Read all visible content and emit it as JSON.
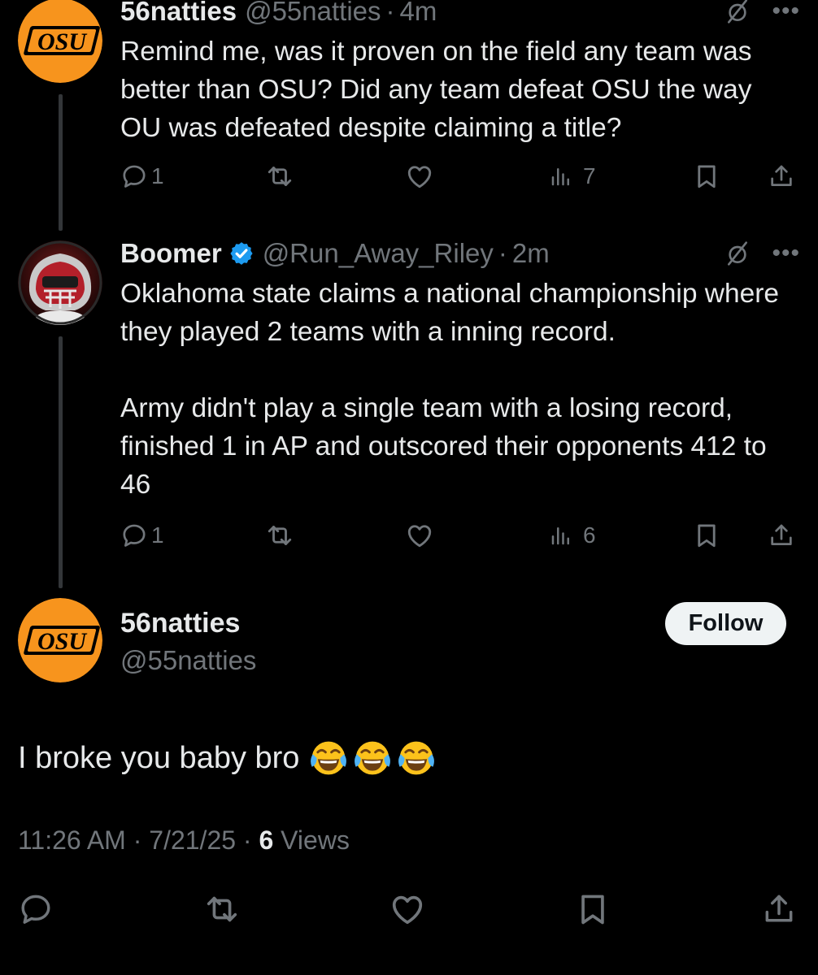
{
  "tweets": [
    {
      "name": "56natties",
      "handle": "@55natties",
      "time": "4m",
      "text": [
        "Remind me, was it proven on the field any team was better than OSU? Did any team defeat OSU the way OU was defeated despite claiming a title?"
      ],
      "reply_count": "1",
      "views": "7",
      "avatar_logo": "OSU"
    },
    {
      "name": "Boomer",
      "handle": "@Run_Away_Riley",
      "time": "2m",
      "verified": true,
      "text": [
        "Oklahoma state claims a national championship where they played 2 teams with a inning record.",
        "Army didn't play a single team with a losing record, finished 1 in AP and outscored their opponents 412 to 46"
      ],
      "reply_count": "1",
      "views": "6"
    }
  ],
  "main_tweet": {
    "name": "56natties",
    "handle": "@55natties",
    "follow_label": "Follow",
    "text": "I broke you baby bro",
    "emojis": [
      "face-with-tears-of-joy",
      "face-with-tears-of-joy",
      "face-with-tears-of-joy"
    ],
    "time": "11:26 AM",
    "date": "7/21/25",
    "views_count": "6",
    "views_label": "Views",
    "avatar_logo": "OSU"
  },
  "separator": "·",
  "icons": [
    "reply-icon",
    "retweet-icon",
    "like-icon",
    "views-icon",
    "bookmark-icon",
    "share-icon",
    "grok-icon",
    "more-icon",
    "verified-icon"
  ],
  "colors": {
    "background": "#000000",
    "text": "#e7e9ea",
    "muted": "#71767b",
    "osu_orange": "#f7941d",
    "verified_blue": "#1d9bf0"
  }
}
